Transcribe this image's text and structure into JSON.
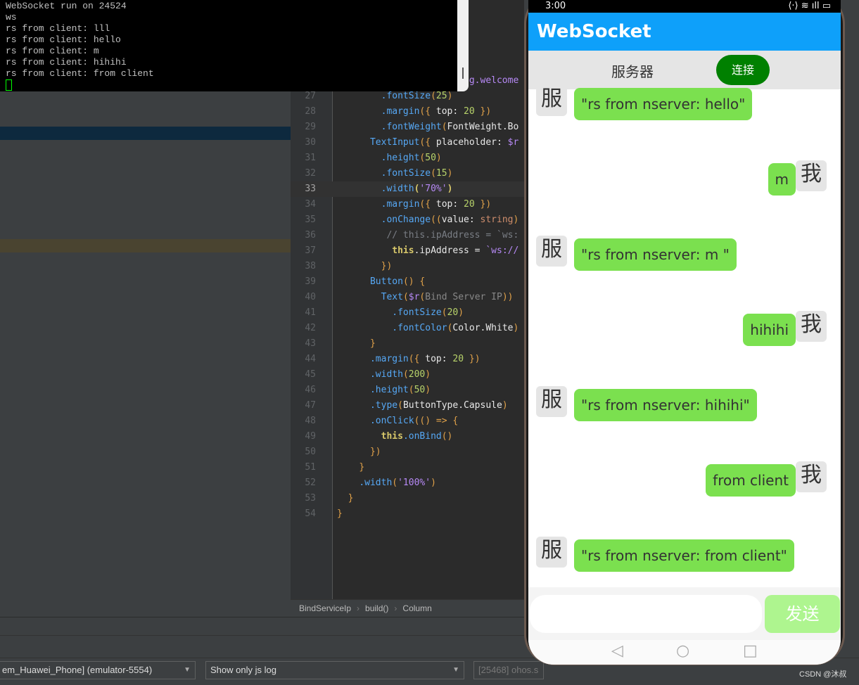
{
  "terminal": {
    "lines": [
      "WebSocket run on 24524",
      "ws",
      "rs from client: lll",
      "rs from client: hello",
      "rs from client: m",
      "rs from client: hihihi",
      "rs from client: from client"
    ]
  },
  "editor": {
    "lines": [
      {
        "n": "",
        "seg": [
          [
            "                       ",
            ""
          ],
          [
            "ng.welcome",
            "s"
          ]
        ]
      },
      {
        "n": "27",
        "seg": [
          [
            "        ",
            ""
          ],
          [
            ".fontSize",
            "m"
          ],
          [
            "(",
            "p"
          ],
          [
            "25",
            "n"
          ],
          [
            ")",
            "p"
          ]
        ]
      },
      {
        "n": "28",
        "seg": [
          [
            "        ",
            ""
          ],
          [
            ".margin",
            "m"
          ],
          [
            "({ ",
            "p"
          ],
          [
            "top",
            "w"
          ],
          [
            ": ",
            "w"
          ],
          [
            "20",
            "n"
          ],
          [
            " })",
            "p"
          ]
        ]
      },
      {
        "n": "29",
        "seg": [
          [
            "        ",
            ""
          ],
          [
            ".fontWeight",
            "m"
          ],
          [
            "(",
            "p"
          ],
          [
            "FontWeight.Bo",
            "w"
          ]
        ]
      },
      {
        "n": "30",
        "seg": [
          [
            "      ",
            ""
          ],
          [
            "TextInput",
            "m"
          ],
          [
            "({ ",
            "p"
          ],
          [
            "placeholder",
            "w"
          ],
          [
            ": ",
            "w"
          ],
          [
            "$r",
            "s"
          ]
        ]
      },
      {
        "n": "31",
        "seg": [
          [
            "        ",
            ""
          ],
          [
            ".height",
            "m"
          ],
          [
            "(",
            "p"
          ],
          [
            "50",
            "n"
          ],
          [
            ")",
            "p"
          ]
        ]
      },
      {
        "n": "32",
        "seg": [
          [
            "        ",
            ""
          ],
          [
            ".fontSize",
            "m"
          ],
          [
            "(",
            "p"
          ],
          [
            "15",
            "n"
          ],
          [
            ")",
            "p"
          ]
        ]
      },
      {
        "n": "33",
        "cur": true,
        "seg": [
          [
            "        ",
            ""
          ],
          [
            ".width",
            "m"
          ],
          [
            "(",
            "t"
          ],
          [
            "'70%'",
            "s"
          ],
          [
            ")",
            "t"
          ]
        ]
      },
      {
        "n": "34",
        "seg": [
          [
            "        ",
            ""
          ],
          [
            ".margin",
            "m"
          ],
          [
            "({ ",
            "p"
          ],
          [
            "top",
            "w"
          ],
          [
            ": ",
            "w"
          ],
          [
            "20",
            "n"
          ],
          [
            " })",
            "p"
          ]
        ]
      },
      {
        "n": "35",
        "seg": [
          [
            "        ",
            ""
          ],
          [
            ".onChange",
            "m"
          ],
          [
            "((",
            "p"
          ],
          [
            "value",
            "w"
          ],
          [
            ": ",
            "w"
          ],
          [
            "string",
            "ty"
          ],
          [
            ")",
            "p"
          ]
        ]
      },
      {
        "n": "36",
        "seg": [
          [
            "         ",
            ""
          ],
          [
            "// this.ipAddress = `ws:",
            "c"
          ]
        ]
      },
      {
        "n": "37",
        "seg": [
          [
            "          ",
            ""
          ],
          [
            "this",
            "t"
          ],
          [
            ".ipAddress = ",
            "w"
          ],
          [
            "`ws://",
            "s"
          ]
        ]
      },
      {
        "n": "38",
        "seg": [
          [
            "        ",
            ""
          ],
          [
            "})",
            "p"
          ]
        ]
      },
      {
        "n": "39",
        "seg": [
          [
            "      ",
            ""
          ],
          [
            "Button",
            "m"
          ],
          [
            "() {",
            "p"
          ]
        ]
      },
      {
        "n": "40",
        "seg": [
          [
            "        ",
            ""
          ],
          [
            "Text",
            "m"
          ],
          [
            "(",
            "p"
          ],
          [
            "$r",
            "s"
          ],
          [
            "(",
            "p"
          ],
          [
            "Bind Server IP",
            "g"
          ],
          [
            ")",
            "p"
          ],
          [
            ")",
            "p"
          ]
        ]
      },
      {
        "n": "41",
        "seg": [
          [
            "          ",
            ""
          ],
          [
            ".fontSize",
            "m"
          ],
          [
            "(",
            "p"
          ],
          [
            "20",
            "n"
          ],
          [
            ")",
            "p"
          ]
        ]
      },
      {
        "n": "42",
        "seg": [
          [
            "          ",
            ""
          ],
          [
            ".fontColor",
            "m"
          ],
          [
            "(",
            "p"
          ],
          [
            "Color.White",
            "w"
          ],
          [
            ")",
            "p"
          ]
        ]
      },
      {
        "n": "43",
        "seg": [
          [
            "      ",
            ""
          ],
          [
            "}",
            "p"
          ]
        ]
      },
      {
        "n": "44",
        "seg": [
          [
            "      ",
            ""
          ],
          [
            ".margin",
            "m"
          ],
          [
            "({ ",
            "p"
          ],
          [
            "top",
            "w"
          ],
          [
            ": ",
            "w"
          ],
          [
            "20",
            "n"
          ],
          [
            " })",
            "p"
          ]
        ]
      },
      {
        "n": "45",
        "seg": [
          [
            "      ",
            ""
          ],
          [
            ".width",
            "m"
          ],
          [
            "(",
            "p"
          ],
          [
            "200",
            "n"
          ],
          [
            ")",
            "p"
          ]
        ]
      },
      {
        "n": "46",
        "seg": [
          [
            "      ",
            ""
          ],
          [
            ".height",
            "m"
          ],
          [
            "(",
            "p"
          ],
          [
            "50",
            "n"
          ],
          [
            ")",
            "p"
          ]
        ]
      },
      {
        "n": "47",
        "seg": [
          [
            "      ",
            ""
          ],
          [
            ".type",
            "m"
          ],
          [
            "(",
            "p"
          ],
          [
            "ButtonType.Capsule",
            "w"
          ],
          [
            ")",
            "p"
          ]
        ]
      },
      {
        "n": "48",
        "seg": [
          [
            "      ",
            ""
          ],
          [
            ".onClick",
            "m"
          ],
          [
            "(() => {",
            "p"
          ]
        ]
      },
      {
        "n": "49",
        "seg": [
          [
            "        ",
            ""
          ],
          [
            "this",
            "t"
          ],
          [
            ".onBind",
            "m"
          ],
          [
            "()",
            "p"
          ]
        ]
      },
      {
        "n": "50",
        "seg": [
          [
            "      ",
            ""
          ],
          [
            "})",
            "p"
          ]
        ]
      },
      {
        "n": "51",
        "seg": [
          [
            "    ",
            ""
          ],
          [
            "}",
            "p"
          ]
        ]
      },
      {
        "n": "52",
        "seg": [
          [
            "    ",
            ""
          ],
          [
            ".width",
            "m"
          ],
          [
            "(",
            "p"
          ],
          [
            "'100%'",
            "s"
          ],
          [
            ")",
            "p"
          ]
        ]
      },
      {
        "n": "53",
        "seg": [
          [
            "  ",
            ""
          ],
          [
            "}",
            "p"
          ]
        ]
      },
      {
        "n": "54",
        "seg": [
          [
            "",
            ""
          ],
          [
            "}",
            "p"
          ]
        ]
      }
    ]
  },
  "breadcrumb": [
    "BindServiceIp",
    "build()",
    "Column"
  ],
  "bottom": {
    "device": "em_Huawei_Phone] (emulator-5554)",
    "log_filter": "Show only js log",
    "process": "[25468] ohos.s"
  },
  "phone": {
    "time": "3:00",
    "status_icons": "⟨·⟩ ≋ ıll ▭",
    "title": "WebSocket",
    "server_label": "服务器",
    "connect_label": "连接",
    "server_avatar": "服",
    "client_avatar": "我",
    "messages": [
      {
        "from": "server",
        "text": "\"rs from nserver: hello\""
      },
      {
        "from": "client",
        "text": "m"
      },
      {
        "from": "server",
        "text": "\"rs from nserver: m \""
      },
      {
        "from": "client",
        "text": "hihihi"
      },
      {
        "from": "server",
        "text": "\"rs from nserver: hihihi\""
      },
      {
        "from": "client",
        "text": "from client"
      },
      {
        "from": "server",
        "text": "\"rs from nserver: from client\""
      }
    ],
    "input_value": "",
    "send_label": "发送",
    "colors": {
      "appbar": "#0ea0fa",
      "bubble": "#7be04f",
      "connect": "#008000",
      "send": "#aef58f"
    }
  },
  "watermark": "CSDN @沐叔"
}
